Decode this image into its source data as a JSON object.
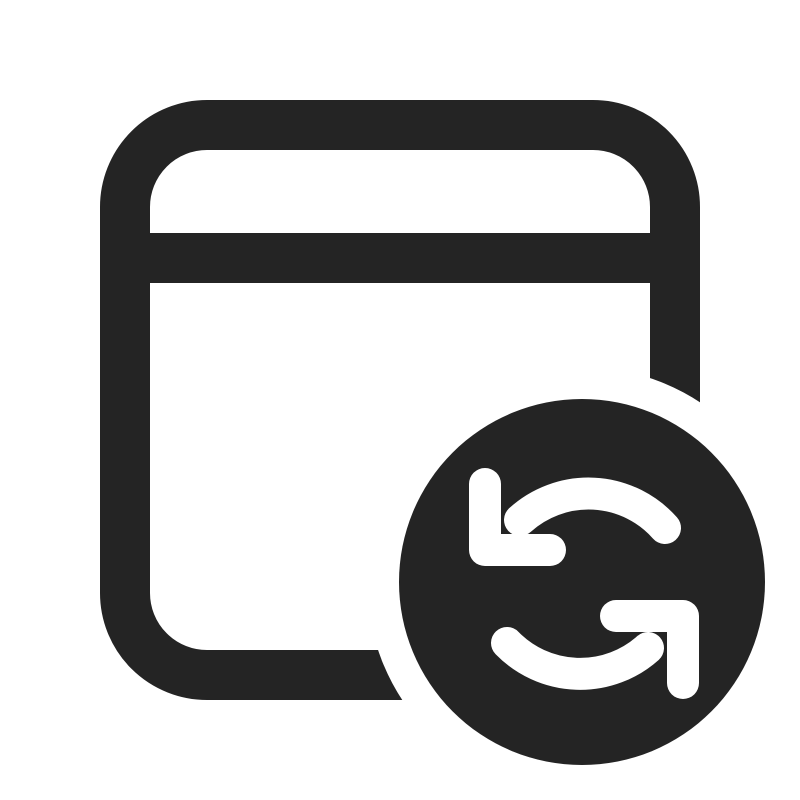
{
  "icon": {
    "name": "calendar-sync-icon",
    "glyph_color": "#242424",
    "background_color": "#ffffff"
  }
}
